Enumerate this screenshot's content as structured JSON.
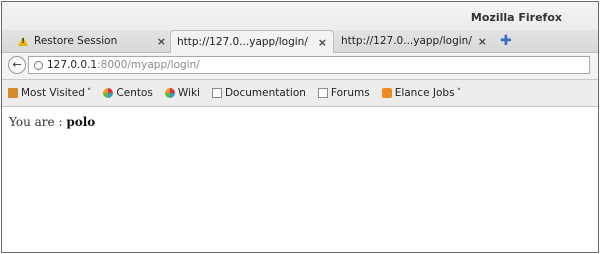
{
  "window": {
    "title": "Mozilla Firefox"
  },
  "tabs": [
    {
      "label": "Restore Session",
      "icon": "warning-icon",
      "active": false
    },
    {
      "label": "http://127.0...yapp/login/",
      "active": true
    },
    {
      "label": "http://127.0...yapp/login/",
      "active": false
    }
  ],
  "tab_close_glyph": "×",
  "new_tab_glyph": "✚",
  "navigation": {
    "back_glyph": "←",
    "url_host": "127.0.0.1",
    "url_rest": ":8000/myapp/login/"
  },
  "bookmarks": [
    {
      "label": "Most Visited",
      "icon": "folder-icon",
      "dropdown": true
    },
    {
      "label": "Centos",
      "icon": "centos-icon",
      "dropdown": false
    },
    {
      "label": "Wiki",
      "icon": "wiki-icon",
      "dropdown": false
    },
    {
      "label": "Documentation",
      "icon": "page-icon",
      "dropdown": false
    },
    {
      "label": "Forums",
      "icon": "page-icon",
      "dropdown": false
    },
    {
      "label": "Elance Jobs",
      "icon": "rss-icon",
      "dropdown": true
    }
  ],
  "dropdown_glyph": "˅",
  "page": {
    "prefix": "You are : ",
    "username": "polo"
  }
}
